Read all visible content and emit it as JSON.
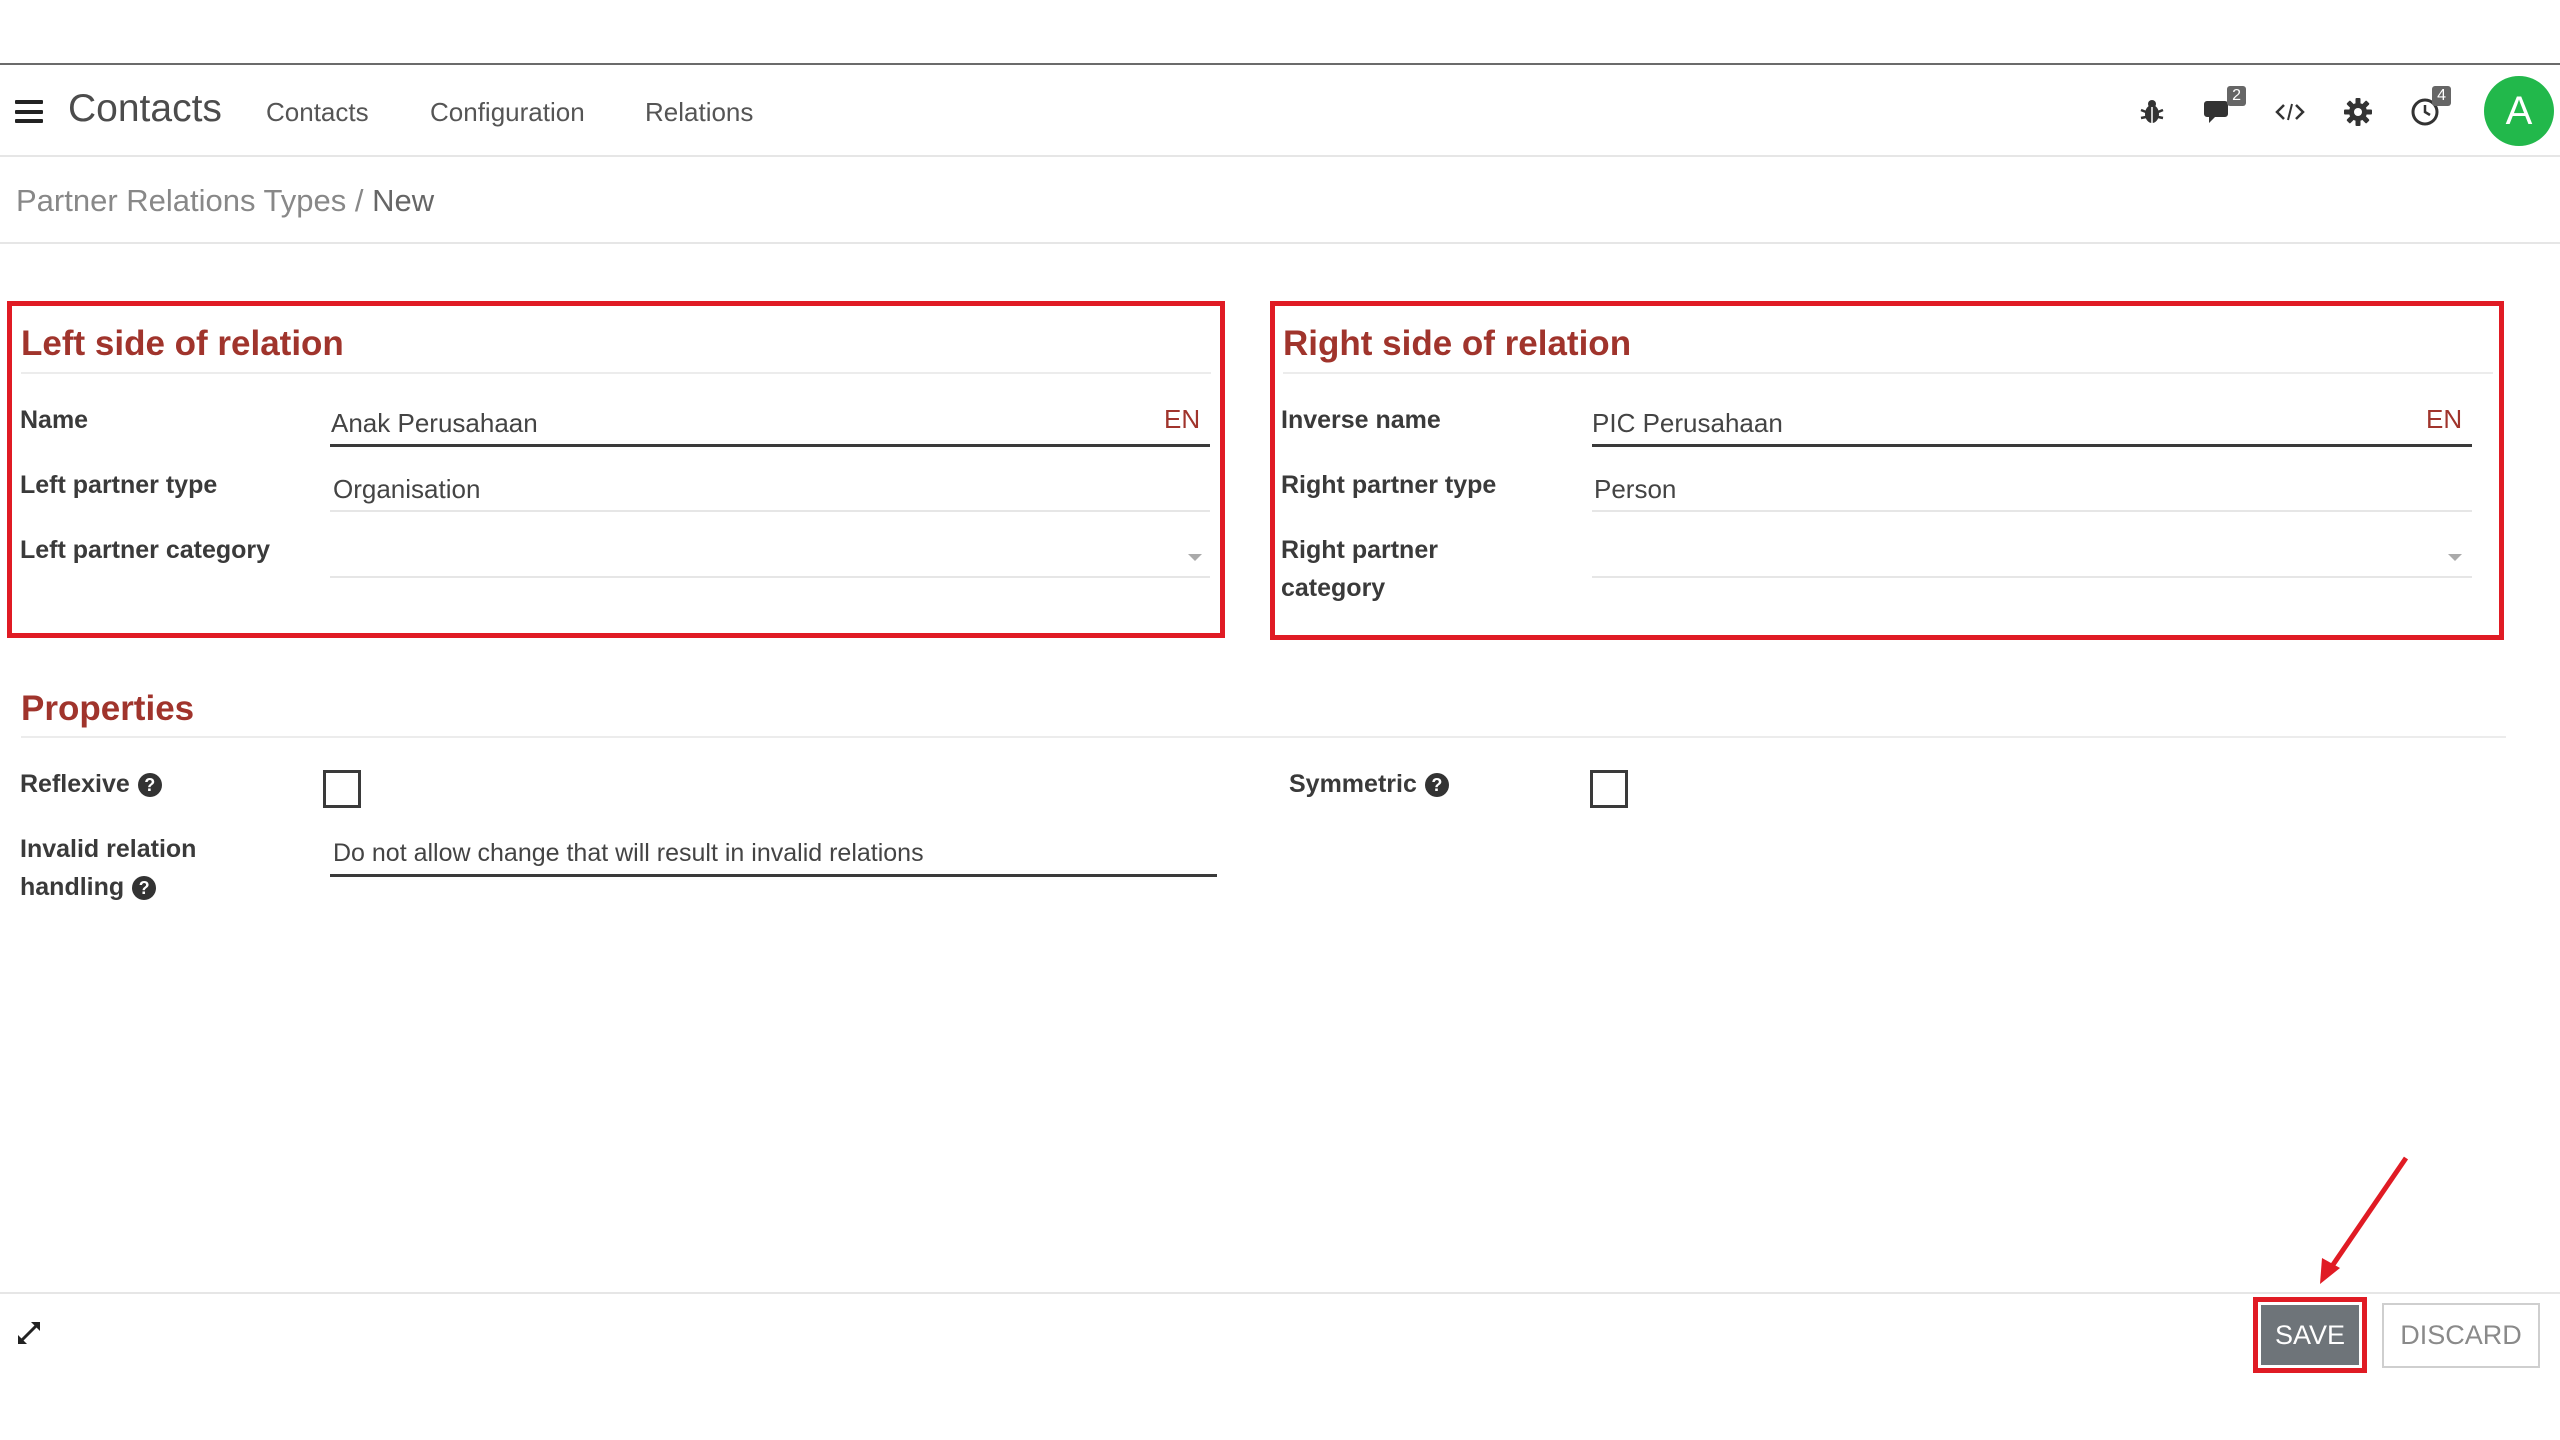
{
  "app": {
    "title": "Contacts"
  },
  "menu": [
    {
      "label": "Contacts"
    },
    {
      "label": "Configuration"
    },
    {
      "label": "Relations"
    }
  ],
  "systray": {
    "messages_count": "2",
    "activities_count": "4",
    "avatar_initial": "A",
    "avatar_color": "#22b84b"
  },
  "breadcrumb": {
    "parent": "Partner Relations Types",
    "separator": " / ",
    "current": "New"
  },
  "left_group": {
    "title": "Left side of relation",
    "name_label": "Name",
    "name_value": "Anak Perusahaan",
    "name_lang": "EN",
    "type_label": "Left partner type",
    "type_value": "Organisation",
    "category_label": "Left partner category",
    "category_value": ""
  },
  "right_group": {
    "title": "Right side of relation",
    "name_label": "Inverse name",
    "name_value": "PIC Perusahaan",
    "name_lang": "EN",
    "type_label": "Right partner type",
    "type_value": "Person",
    "category_label_line1": "Right partner",
    "category_label_line2": "category",
    "category_value": ""
  },
  "properties": {
    "title": "Properties",
    "reflexive_label": "Reflexive",
    "reflexive_checked": false,
    "symmetric_label": "Symmetric",
    "symmetric_checked": false,
    "invalid_label_line1": "Invalid relation",
    "invalid_label_line2": "handling",
    "invalid_value": "Do not allow change that will result in invalid relations"
  },
  "help_glyph": "?",
  "footer": {
    "save_label": "SAVE",
    "discard_label": "DISCARD"
  },
  "colors": {
    "accent_red": "#e01b24",
    "title_color": "#a0342c",
    "save_bg": "#6e7479"
  }
}
